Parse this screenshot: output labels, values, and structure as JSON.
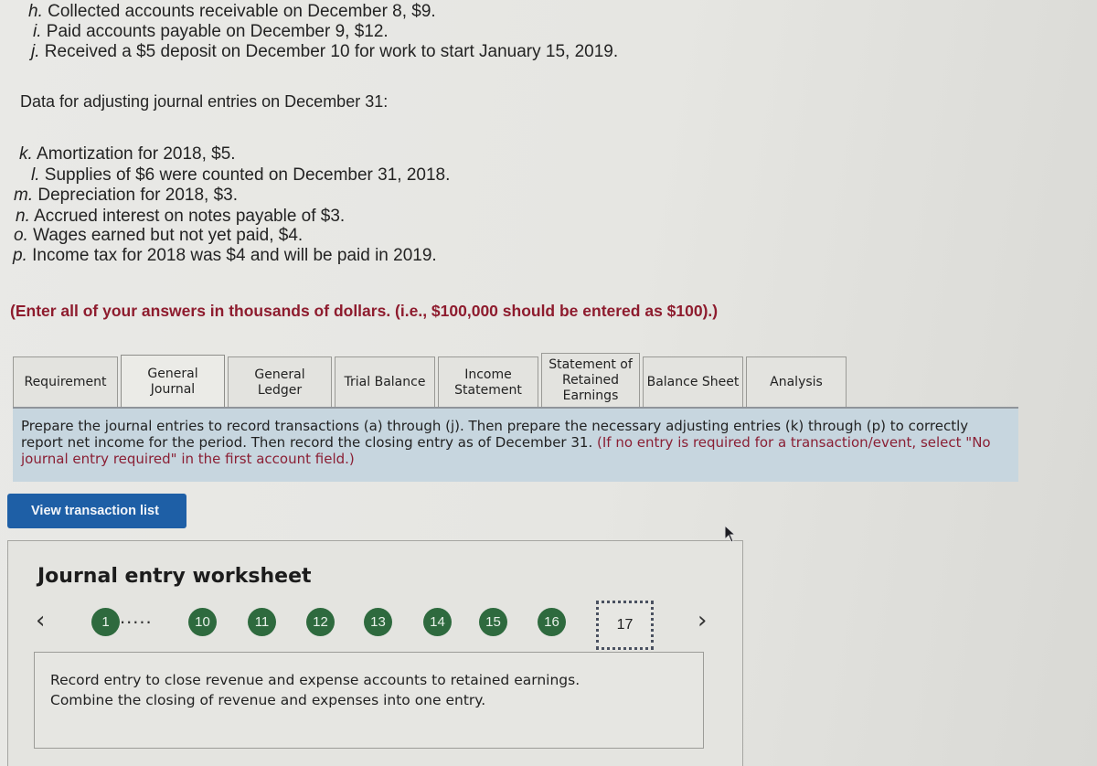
{
  "transactions": [
    {
      "label": "h.",
      "text": "Collected accounts receivable on December 8, $9."
    },
    {
      "label": "i.",
      "text": "Paid accounts payable on December 9, $12."
    },
    {
      "label": "j.",
      "text": "Received a $5 deposit on December 10 for work to start January 15, 2019."
    }
  ],
  "adjusting_heading": "Data for adjusting journal entries on December 31:",
  "adjustments": [
    {
      "label": "k.",
      "text": "Amortization for 2018, $5."
    },
    {
      "label": "l.",
      "text": "Supplies of $6 were counted on December 31, 2018."
    },
    {
      "label": "m.",
      "text": "Depreciation for 2018, $3."
    },
    {
      "label": "n.",
      "text": "Accrued interest on notes payable of $3."
    },
    {
      "label": "o.",
      "text": "Wages earned but not yet paid, $4."
    },
    {
      "label": "p.",
      "text": "Income tax for 2018 was $4 and will be paid in 2019."
    }
  ],
  "note": "(Enter all of your answers in thousands of dollars. (i.e., $100,000 should be entered as $100).)",
  "tabs": [
    {
      "label": "Requirement",
      "active": false
    },
    {
      "label": "General\nJournal",
      "active": true
    },
    {
      "label": "General\nLedger",
      "active": false
    },
    {
      "label": "Trial Balance",
      "active": false
    },
    {
      "label": "Income\nStatement",
      "active": false
    },
    {
      "label": "Statement of\nRetained\nEarnings",
      "active": false
    },
    {
      "label": "Balance Sheet",
      "active": false
    },
    {
      "label": "Analysis",
      "active": false
    }
  ],
  "instructions": {
    "main": "Prepare the journal entries to record transactions (a) through (j). Then prepare the necessary adjusting entries (k) through (p) to correctly report net income for the period. Then record the closing entry as of December 31.",
    "note": "(If no entry is required for a transaction/event, select \"No journal entry required\" in the first account field.)"
  },
  "view_transaction_button": "View transaction list",
  "worksheet": {
    "title": "Journal entry worksheet",
    "prev_icon": "chevron-left-icon",
    "next_icon": "chevron-right-icon",
    "pages": [
      "1",
      "10",
      "11",
      "12",
      "13",
      "14",
      "15",
      "16"
    ],
    "ellipsis": ".....",
    "current_page": "17",
    "prompt_line1": "Record entry to close revenue and expense accounts to retained earnings.",
    "prompt_line2": "Combine the closing of revenue and expenses into one entry."
  },
  "colors": {
    "accent_button": "#1e5fa6",
    "page_circle": "#2e6a3e",
    "note_red": "#8e1c2e",
    "instruction_bg": "#c7d6df"
  }
}
